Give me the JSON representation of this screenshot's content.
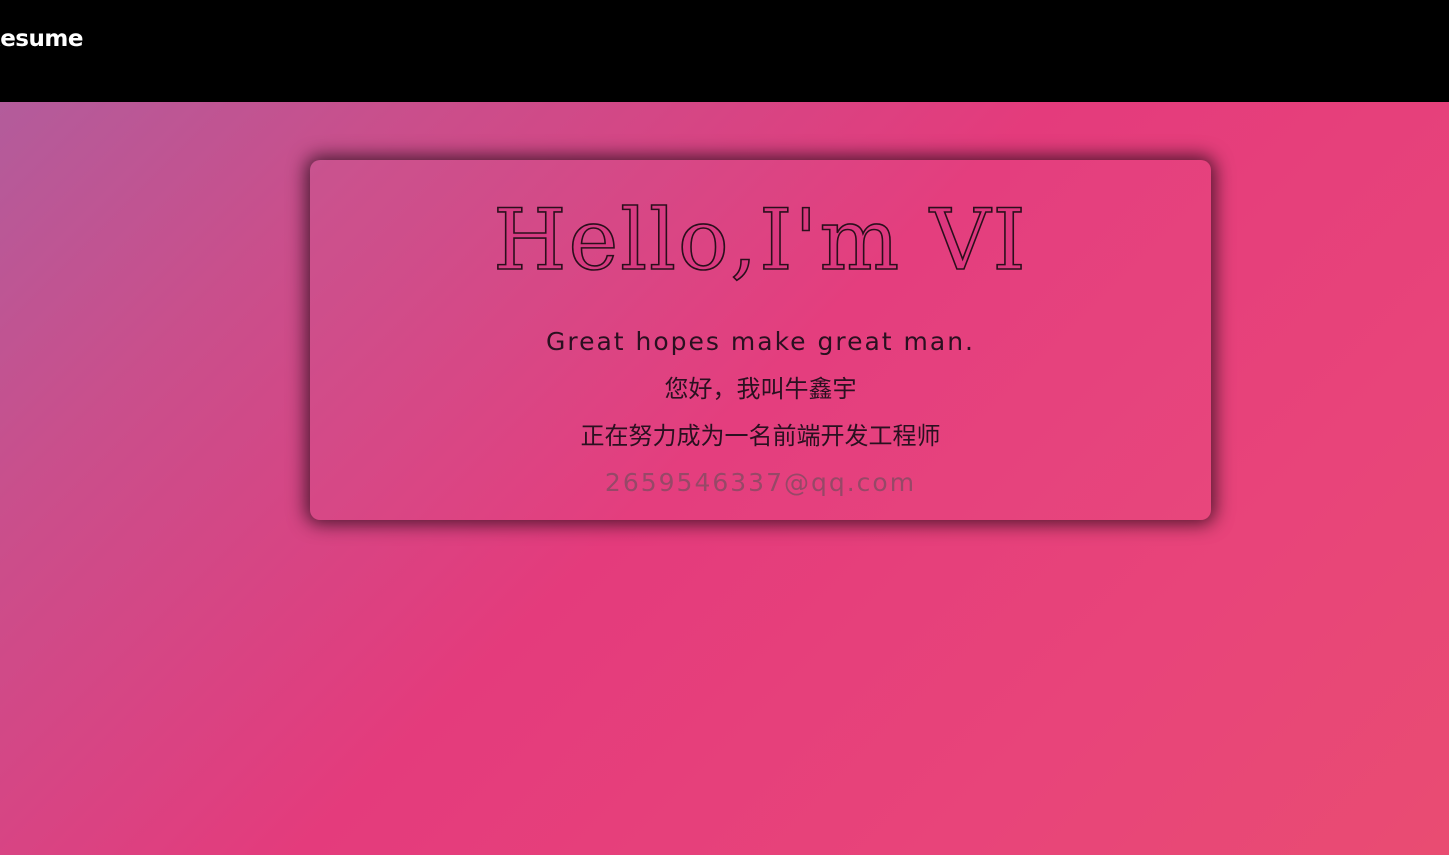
{
  "header": {
    "brand_label": "Resume",
    "background_color": "#000000"
  },
  "intro_card": {
    "headline": "Hello,I'm VI",
    "motto": "Great hopes make great man.",
    "greeting_cn": "您好，我叫牛鑫宇",
    "goal_cn": "正在努力成为一名前端开发工程师",
    "email": "2659546337@qq.com"
  },
  "colors": {
    "gradient_start": "#ad5f9f",
    "gradient_mid": "#e43b7c",
    "gradient_end": "#e94c72",
    "text_dark": "#2a1020",
    "email_text": "#8a4a64"
  }
}
